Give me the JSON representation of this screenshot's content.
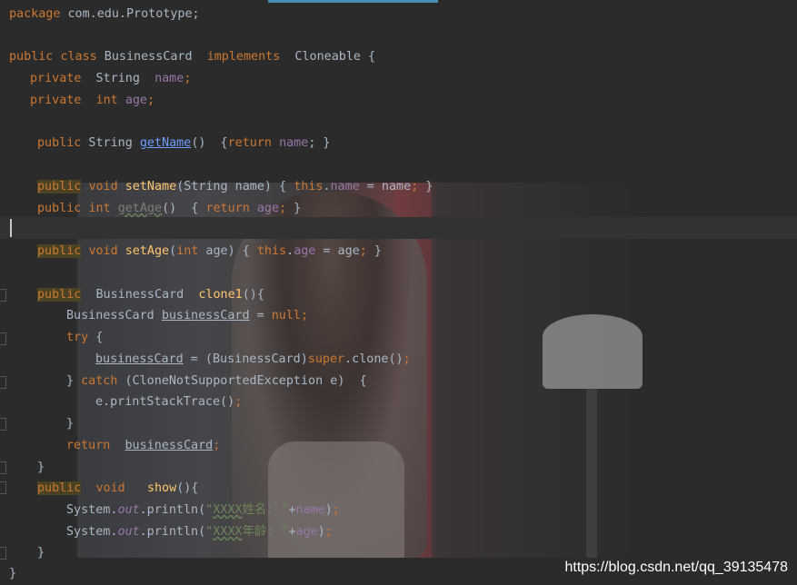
{
  "editor": {
    "lines": {
      "l1": {
        "pkg_kw": "package",
        "pkg_name": " com.edu.Prototype;"
      },
      "l3": {
        "public": "public",
        "class": "class",
        "name": " BusinessCard  ",
        "implements": "implements",
        "iface": "  Cloneable {"
      },
      "l4": {
        "private": "private",
        "type": "  String  ",
        "field": "name",
        "semi": ";"
      },
      "l5": {
        "private": "private",
        "int": "int",
        "field": "age",
        "semi": ";"
      },
      "l7": {
        "public": "public",
        "ret": " String ",
        "method": "getName",
        "rest": "()  {",
        "kw_return": "return",
        "field": "name",
        "end": "; }"
      },
      "l9": {
        "public": "public",
        "void": "void",
        "method": "setName",
        "params": "(String name) { ",
        "this": "this",
        "dot": ".",
        "field": "name",
        "assign": " = name",
        "semi": ";",
        "end": " }"
      },
      "l10": {
        "public": "public",
        "int": "int",
        "method": "getAge",
        "rest": "()  { ",
        "kw_return": "return",
        "field": "age",
        "semi": ";",
        "end": " }"
      },
      "l12": {
        "public": "public",
        "void": "void",
        "method": "setAge",
        "paren": "(",
        "int": "int",
        "params": " age) { ",
        "this": "this",
        "dot": ".",
        "field": "age",
        "assign": " = age",
        "semi": ";",
        "end": " }"
      },
      "l14": {
        "public": "public",
        "type": "  BusinessCard  ",
        "method": "clone1",
        "rest": "(){"
      },
      "l15": {
        "type": "BusinessCard ",
        "var": "businessCard",
        "assign": " = ",
        "null": "null",
        "semi": ";"
      },
      "l16": {
        "try": "try",
        "brace": " {"
      },
      "l17": {
        "var": "businessCard",
        "assign": " = (BusinessCard)",
        "super": "super",
        "call": ".clone()",
        "semi": ";"
      },
      "l18": {
        "close": "} ",
        "catch": "catch",
        "rest": " (CloneNotSupportedException e)  {"
      },
      "l19": {
        "call": "e.printStackTrace()",
        "semi": ";"
      },
      "l20": {
        "close": "}"
      },
      "l21": {
        "return": "return",
        "var": "businessCard",
        "semi": ";"
      },
      "l22": {
        "close": "}"
      },
      "l23": {
        "public": "public",
        "void": "void",
        "method": "show",
        "rest": "(){"
      },
      "l24": {
        "sys": "System.",
        "out": "out",
        "call": ".println(",
        "q": "\"",
        "xx": "XXXX",
        "label": "姓名: \"",
        "plus": "+",
        "field": "name",
        "end": ")",
        "semi": ";"
      },
      "l25": {
        "sys": "System.",
        "out": "out",
        "call": ".println(",
        "q": "\"",
        "xx": "XXXX",
        "label": "年龄: \"",
        "plus": "+",
        "field": "age",
        "end": ")",
        "semi": ";"
      },
      "l26": {
        "close": "}"
      },
      "l27": {
        "close": "}"
      }
    }
  },
  "watermark": "https://blog.csdn.net/qq_39135478",
  "colors": {
    "background": "#2b2b2b",
    "keyword": "#cc7832",
    "field": "#9876aa",
    "method": "#ffc66d",
    "string": "#6a8759",
    "text": "#a9b7c6",
    "link": "#6f9eff"
  }
}
